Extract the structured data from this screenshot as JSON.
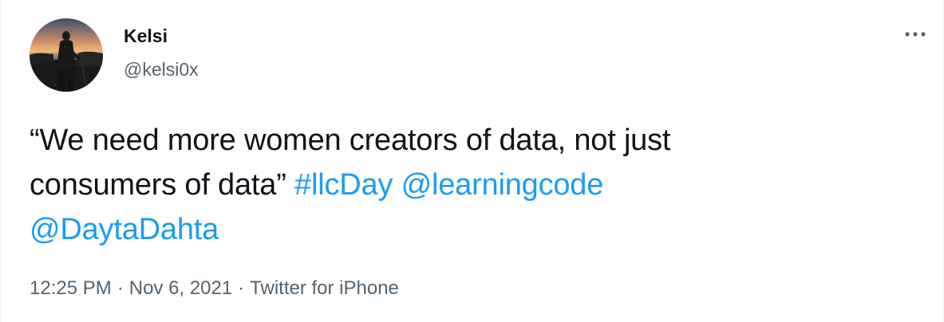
{
  "author": {
    "display_name": "Kelsi",
    "handle": "@kelsi0x"
  },
  "tweet": {
    "text_line1": "“We need more women creators of data, not just",
    "text_line2_prefix": "consumers of data”",
    "hashtag": "#llcDay",
    "mention1": "@learningcode",
    "mention2": "@DaytaDahta"
  },
  "meta": {
    "time": "12:25 PM",
    "date": "Nov 6, 2021",
    "separator": "·",
    "source": "Twitter for iPhone"
  },
  "colors": {
    "link": "#1d9bf0",
    "text": "#0f1419",
    "secondary": "#536471"
  },
  "icons": {
    "more": "more-options-icon",
    "avatar": "avatar-silhouette-sunset"
  }
}
